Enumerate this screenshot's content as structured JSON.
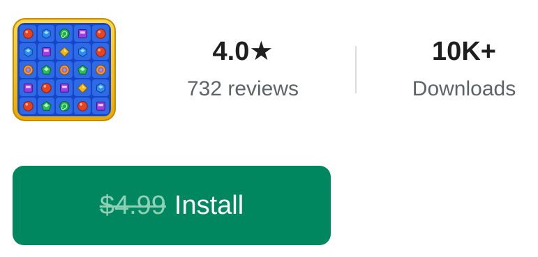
{
  "app": {
    "icon_name": "jewel-match-game-icon",
    "board_gems": [
      [
        "red-round",
        "blue-hex",
        "green-swirl",
        "purple-square",
        "red-round"
      ],
      [
        "blue-hex",
        "purple-square",
        "yellow-diamond",
        "blue-hex",
        "red-round"
      ],
      [
        "multi-wheel",
        "green-pentagon",
        "multi-wheel",
        "green-pentagon",
        "multi-wheel"
      ],
      [
        "purple-square",
        "red-round",
        "purple-square",
        "yellow-diamond",
        "blue-hex"
      ],
      [
        "red-round",
        "green-pentagon",
        "green-swirl",
        "red-round",
        "purple-square"
      ]
    ]
  },
  "stats": {
    "rating": {
      "value": "4.0★",
      "label": "732 reviews"
    },
    "downloads": {
      "value": "10K+",
      "label": "Downloads"
    }
  },
  "install": {
    "old_price": "$4.99",
    "label": "Install",
    "color": "#01875f"
  }
}
